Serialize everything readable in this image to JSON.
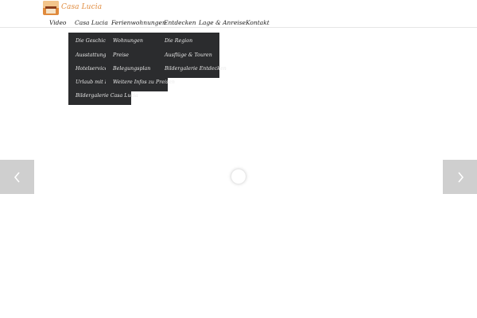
{
  "brand": {
    "name": "Casa Lucia",
    "logo": "house-logo"
  },
  "colors": {
    "accent": "#e08a3c",
    "dropdown_bg": "#2b2c2e",
    "arrow_bg": "#cfcfcf"
  },
  "nav": {
    "items": [
      {
        "label": "Video"
      },
      {
        "label": "Casa Lucia"
      },
      {
        "label": "Ferienwohnungen"
      },
      {
        "label": "Entdecken"
      },
      {
        "label": "Lage & Anreise"
      },
      {
        "label": "Kontakt"
      }
    ]
  },
  "menus": {
    "casa_lucia": [
      "Die Geschichte",
      "Ausstattung",
      "Hotelservice",
      "Urlaub mit Hu",
      "Bildergalerie Casa Lucia"
    ],
    "ferienwohnungen": [
      "Wohnungen",
      "Preise",
      "Belegungsplan",
      "Weitere Infos zu Preisen"
    ],
    "entdecken": [
      "Die Region",
      "Ausflüge & Touren",
      "Bildergalerie Entdecken"
    ]
  },
  "slider": {
    "prev_icon": "chevron-left-icon",
    "next_icon": "chevron-right-icon",
    "loader_icon": "loading-spinner-icon"
  }
}
